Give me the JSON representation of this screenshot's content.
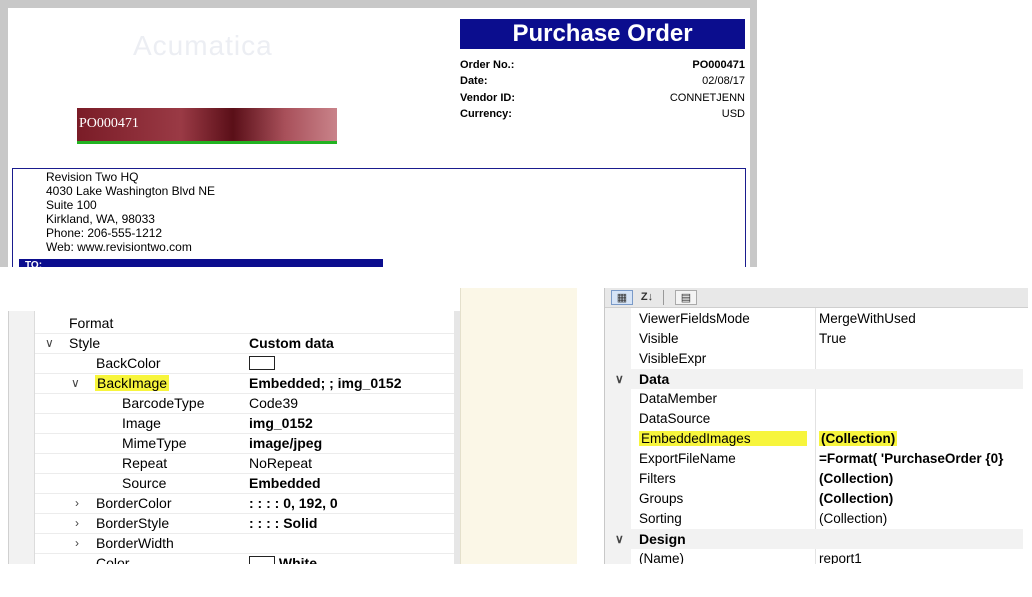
{
  "report": {
    "logo_text": "Acumatica",
    "title": "Purchase Order",
    "info": [
      {
        "label": "Order No.:",
        "value": "PO000471"
      },
      {
        "label": "Date:",
        "value": "02/08/17"
      },
      {
        "label": "Vendor ID:",
        "value": "CONNETJENN"
      },
      {
        "label": "Currency:",
        "value": "USD"
      }
    ],
    "barcode_text": "PO000471",
    "address_lines": [
      "Revision Two HQ",
      "4030 Lake Washington Blvd NE",
      "Suite 100",
      "Kirkland, WA, 98033",
      "Phone: 206-555-1212",
      "Web: www.revisiontwo.com"
    ],
    "to_label": "TO:",
    "colors": {
      "banner": "#0b0d8e",
      "underline": "#22b322"
    }
  },
  "left_grid": {
    "rows": [
      {
        "name": "Format",
        "value": ""
      },
      {
        "name": "Style",
        "value": "Custom data"
      },
      {
        "name": "BackColor",
        "value": ""
      },
      {
        "name": "BackImage",
        "value": "Embedded; ; img_0152"
      },
      {
        "name": "BarcodeType",
        "value": "Code39"
      },
      {
        "name": "Image",
        "value": "img_0152"
      },
      {
        "name": "MimeType",
        "value": "image/jpeg"
      },
      {
        "name": "Repeat",
        "value": "NoRepeat"
      },
      {
        "name": "Source",
        "value": "Embedded"
      },
      {
        "name": "BorderColor",
        "value": ": : : : 0, 192, 0"
      },
      {
        "name": "BorderStyle",
        "value": ": : : : Solid"
      },
      {
        "name": "BorderWidth",
        "value": ""
      },
      {
        "name": "Color",
        "value": "White"
      }
    ]
  },
  "right_grid": {
    "toolbar": {
      "alpha_label": "Z↓"
    },
    "rows": [
      {
        "name": "ViewerFieldsMode",
        "value": "MergeWithUsed"
      },
      {
        "name": "Visible",
        "value": "True"
      },
      {
        "name": "VisibleExpr",
        "value": ""
      },
      {
        "category": "Data"
      },
      {
        "name": "DataMember",
        "value": ""
      },
      {
        "name": "DataSource",
        "value": ""
      },
      {
        "name": "EmbeddedImages",
        "value": "(Collection)"
      },
      {
        "name": "ExportFileName",
        "value": "=Format( 'PurchaseOrder {0}"
      },
      {
        "name": "Filters",
        "value": "(Collection)"
      },
      {
        "name": "Groups",
        "value": "(Collection)"
      },
      {
        "name": "Sorting",
        "value": "(Collection)"
      },
      {
        "category": "Design"
      },
      {
        "name": "(Name)",
        "value": "report1"
      }
    ]
  },
  "highlight_color": "#f7f53c"
}
